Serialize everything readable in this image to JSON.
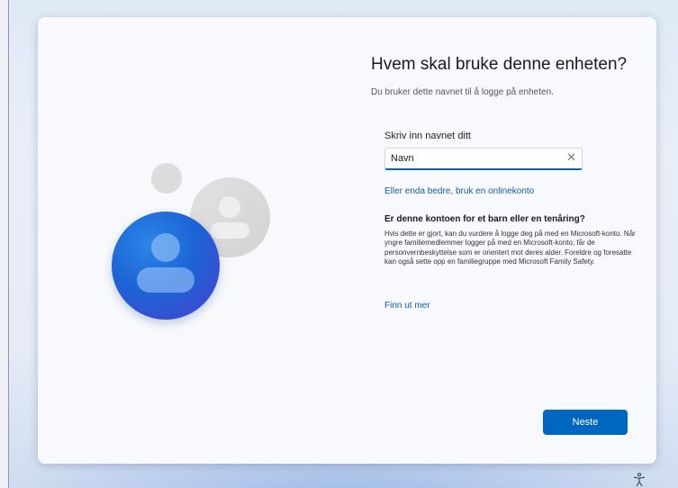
{
  "setup": {
    "title": "Hvem skal bruke denne enheten?",
    "subtitle": "Du bruker dette navnet til å logge på enheten.",
    "name_field": {
      "label": "Skriv inn navnet ditt",
      "value": "Navn",
      "clear_icon": "close-icon"
    },
    "online_account_link": "Eller enda bedre, bruk en onlinekonto",
    "child_section": {
      "heading": "Er denne kontoen for et barn eller en tenåring?",
      "body": "Hvis dette er gjort, kan du vurdere å logge deg på med en Microsoft-konto. Når yngre familiemedlemmer logger på med en Microsoft-konto, får de personvernbeskyttelse som er orientert mot deres alder. Foreldre og foresatte kan også sette opp en familiegruppe med Microsoft Family Safety.",
      "learn_more": "Finn ut mer"
    },
    "next_button": "Neste"
  },
  "icons": {
    "illustration": "user-accounts-illustration",
    "accessibility": "accessibility-icon"
  },
  "colors": {
    "accent": "#0067c0",
    "link": "#0f5cb3"
  }
}
